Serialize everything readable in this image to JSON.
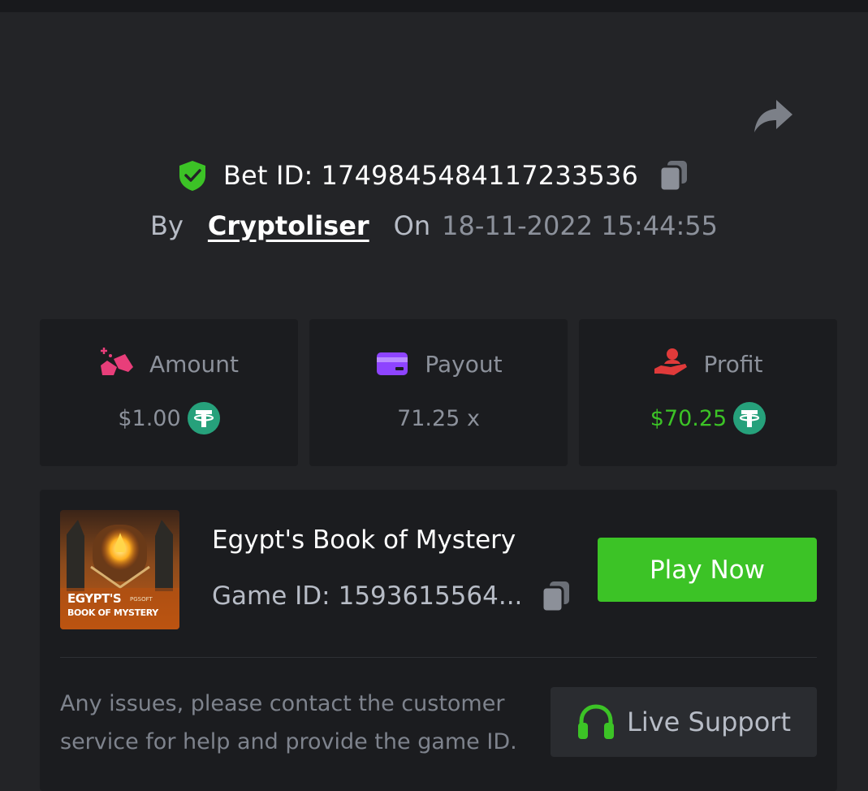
{
  "bet": {
    "id_label": "Bet ID:",
    "id_value": "1749845484117233536",
    "by_label": "By",
    "username": "Cryptoliser",
    "on_label": "On",
    "datetime": "18-11-2022 15:44:55"
  },
  "stats": [
    {
      "label": "Amount",
      "value": "$1.00",
      "icon": "amount-icon",
      "currency_icon": "tether-coin-icon"
    },
    {
      "label": "Payout",
      "value": "71.25 x",
      "icon": "card-icon"
    },
    {
      "label": "Profit",
      "value": "$70.25",
      "icon": "profit-hand-icon",
      "currency_icon": "tether-coin-icon"
    }
  ],
  "game": {
    "name": "Egypt's Book of Mystery",
    "id_label": "Game ID:",
    "id_value": "1593615564...",
    "thumb_title_line1": "EGYPT'S",
    "thumb_title_line2": "BOOK OF MYSTERY",
    "thumb_brand": "PGSOFT",
    "play_label": "Play Now"
  },
  "support": {
    "help_text": "Any issues, please contact the customer service for help and provide the game ID.",
    "button_label": "Live Support"
  },
  "colors": {
    "background": "#232427",
    "card": "#1b1c1f",
    "accent_green": "#3cc326",
    "tether_green": "#26a17b",
    "muted_text": "#8c919b",
    "amount_pink": "#e83e7a",
    "payout_purple": "#8e44ff",
    "profit_red": "#e03a3a"
  }
}
